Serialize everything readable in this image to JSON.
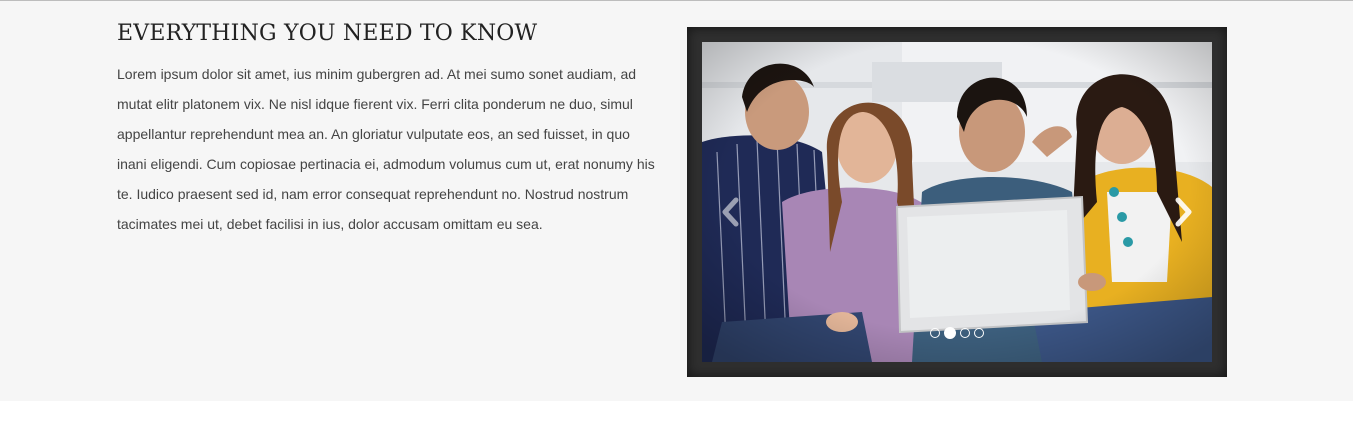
{
  "section": {
    "heading": "EVERYTHING YOU NEED TO KNOW",
    "body": "Lorem ipsum dolor sit amet, ius minim gubergren ad. At mei sumo sonet audiam, ad mutat elitr platonem vix. Ne nisl idque fierent vix. Ferri clita ponderum ne duo, simul appellantur reprehendunt mea an. An gloriatur vulputate eos, an sed fuisset, in quo inani eligendi. Cum copiosae pertinacia ei, admodum volumus cum ut, erat nonumy his te. Iudico praesent sed id, nam error consequat reprehendunt no. Nostrud nostrum tacimates mei ut, debet facilisi in ius, dolor accusam omittam eu sea."
  },
  "slider": {
    "prev_icon": "chevron-left-icon",
    "next_icon": "chevron-right-icon",
    "slide_count": 4,
    "active_slide": 2
  },
  "colors": {
    "section_bg": "#f6f6f6",
    "frame": "#2f2f2f",
    "heading": "#222222",
    "text": "#444444"
  }
}
